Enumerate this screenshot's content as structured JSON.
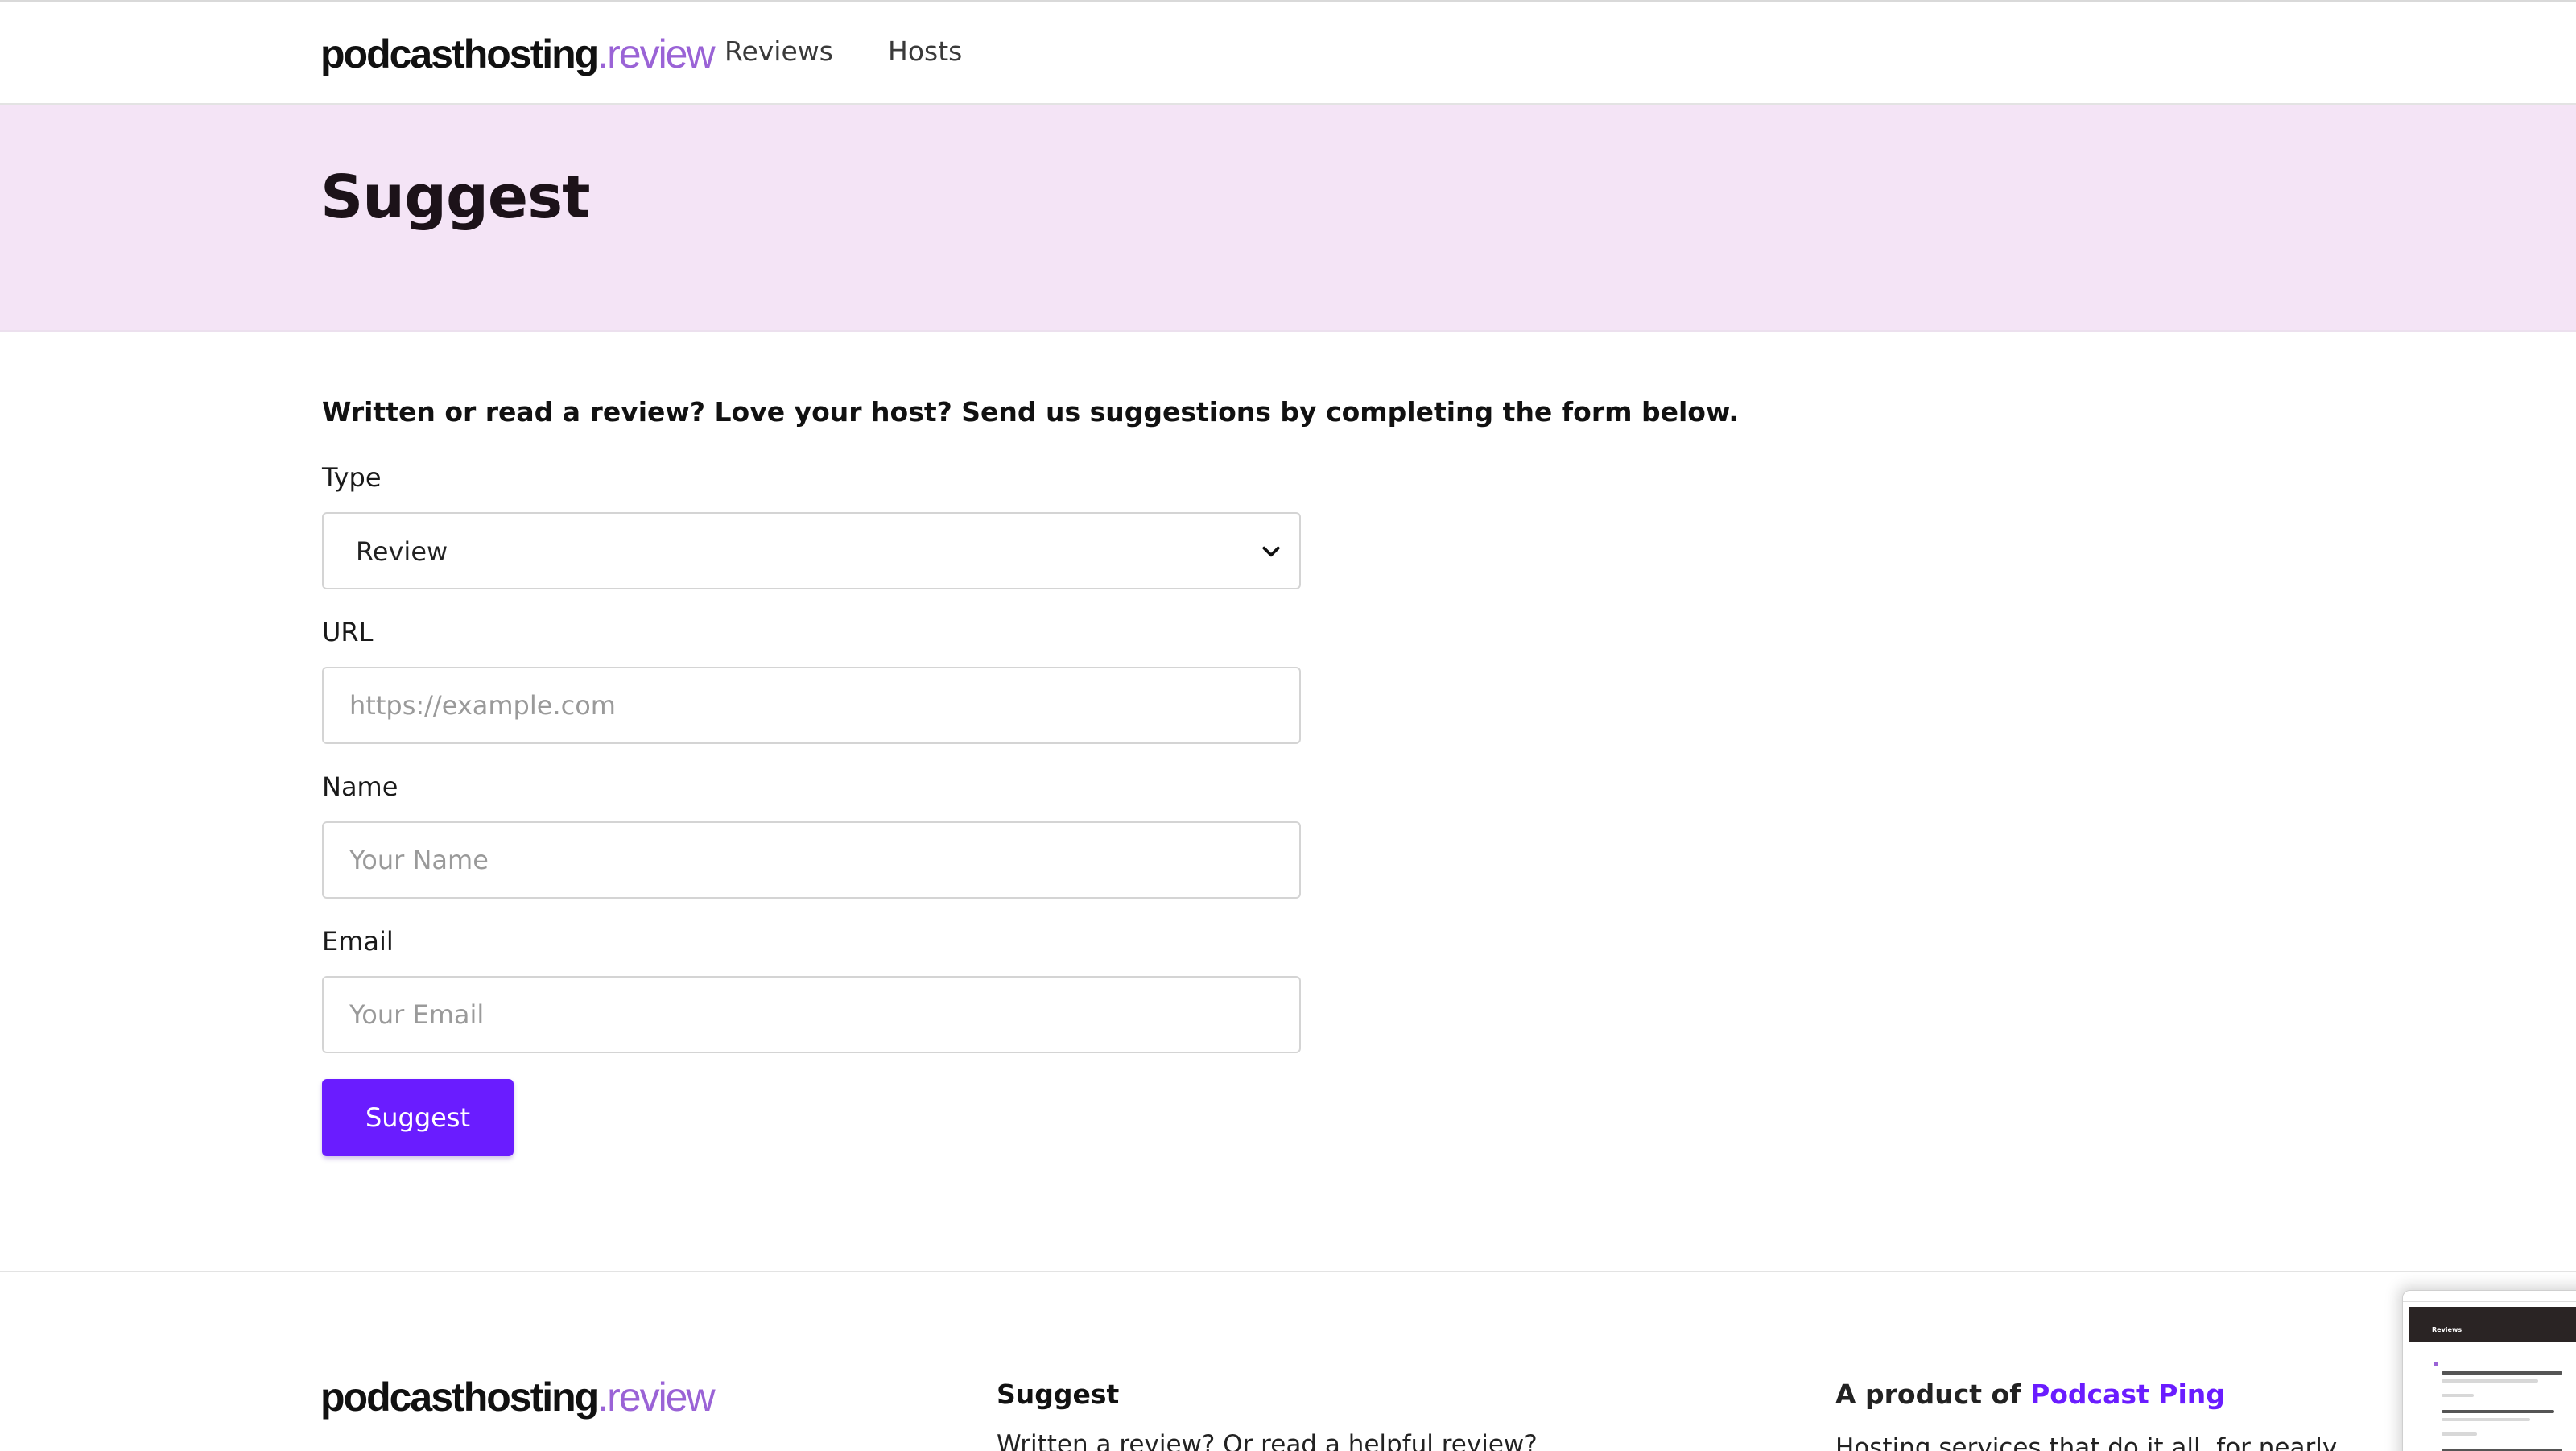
{
  "header": {
    "logo_main": "podcasthosting",
    "logo_accent": ".review",
    "nav": [
      {
        "label": "Reviews"
      },
      {
        "label": "Hosts"
      }
    ]
  },
  "hero": {
    "title": "Suggest"
  },
  "form": {
    "intro": "Written or read a review? Love your host? Send us suggestions by completing the form below.",
    "type_label": "Type",
    "type_selected": "Review",
    "url_label": "URL",
    "url_placeholder": "https://example.com",
    "name_label": "Name",
    "name_placeholder": "Your Name",
    "email_label": "Email",
    "email_placeholder": "Your Email",
    "submit_label": "Suggest"
  },
  "footer": {
    "logo_main": "podcasthosting",
    "logo_accent": ".review",
    "suggest_heading": "Suggest",
    "suggest_text": "Written a review? Or read a helpful review?",
    "product_prefix": "A product of",
    "product_link": "Podcast Ping",
    "product_text": "Hosting services that do it all, for nearly"
  },
  "thumbnail": {
    "title": "Reviews"
  },
  "colors": {
    "accent": "#6a1cff",
    "logo_accent": "#9a63d6",
    "hero_bg": "#f4e4f6"
  }
}
